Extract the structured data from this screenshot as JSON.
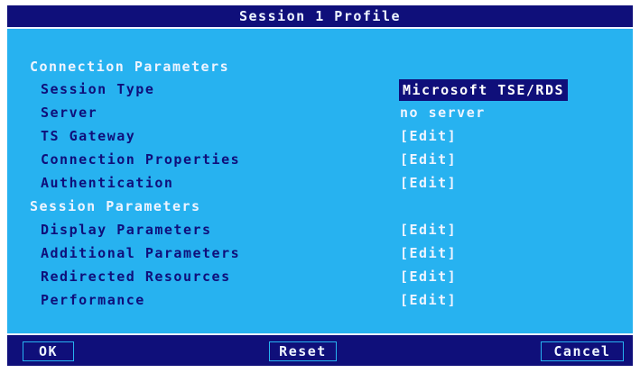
{
  "window": {
    "title": "Session 1 Profile"
  },
  "sections": {
    "connection": {
      "label": "Connection Parameters"
    },
    "session": {
      "label": "Session Parameters"
    }
  },
  "rows": [
    {
      "label": "Session Type",
      "value": "Microsoft TSE/RDS"
    },
    {
      "label": "Server",
      "value": "no server"
    },
    {
      "label": "TS Gateway",
      "value": "[Edit]"
    },
    {
      "label": "Connection Properties",
      "value": "[Edit]"
    },
    {
      "label": "Authentication",
      "value": "[Edit]"
    },
    {
      "label": "Display Parameters",
      "value": "[Edit]"
    },
    {
      "label": "Additional Parameters",
      "value": "[Edit]"
    },
    {
      "label": "Redirected Resources",
      "value": "[Edit]"
    },
    {
      "label": "Performance",
      "value": "[Edit]"
    }
  ],
  "buttons": {
    "ok": "OK",
    "reset": "Reset",
    "cancel": "Cancel"
  },
  "colors": {
    "background": "#27b2f0",
    "titlebar": "#0f0f7a",
    "text_light": "#eef4ff",
    "text_dark": "#0f0f7a"
  }
}
